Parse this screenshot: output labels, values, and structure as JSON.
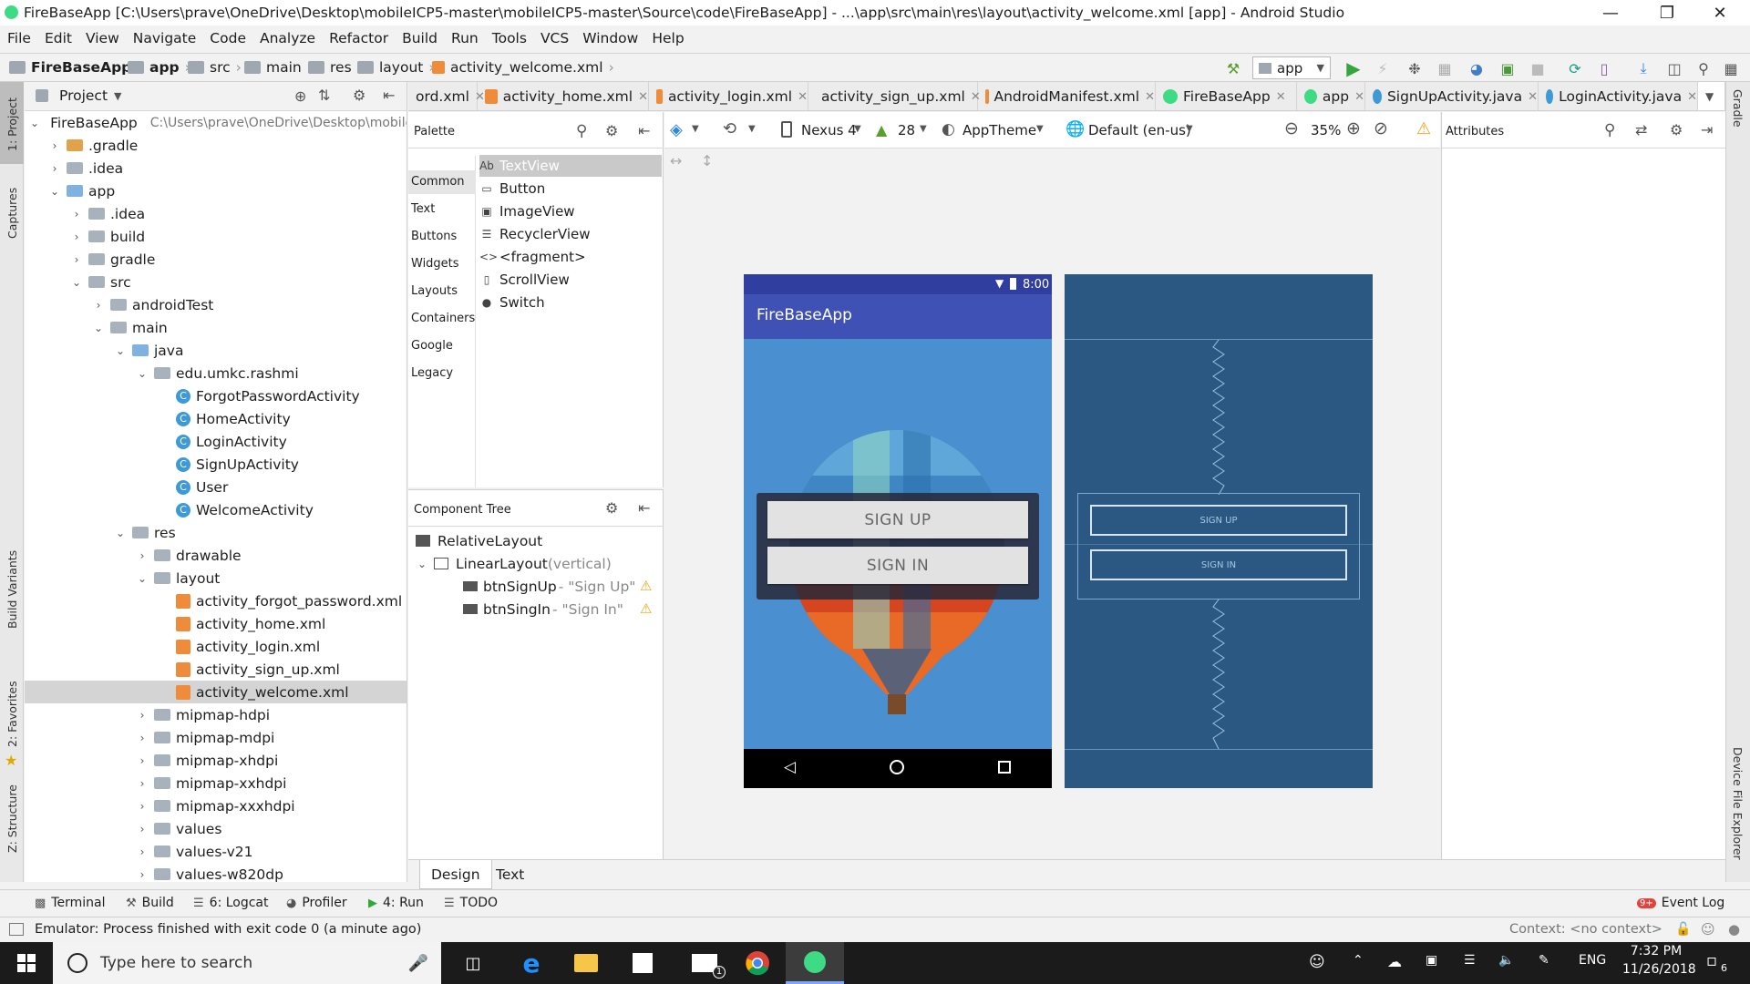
{
  "window": {
    "title": "FireBaseApp [C:\\Users\\prave\\OneDrive\\Desktop\\mobileICP5-master\\mobileICP5-master\\Source\\code\\FireBaseApp] - ...\\app\\src\\main\\res\\layout\\activity_welcome.xml [app] - Android Studio"
  },
  "menu": [
    "File",
    "Edit",
    "View",
    "Navigate",
    "Code",
    "Analyze",
    "Refactor",
    "Build",
    "Run",
    "Tools",
    "VCS",
    "Window",
    "Help"
  ],
  "breadcrumbs": [
    "FireBaseApp",
    "app",
    "src",
    "main",
    "res",
    "layout",
    "activity_welcome.xml"
  ],
  "toolbar": {
    "run_config": "app"
  },
  "left_strip": {
    "project": "1: Project",
    "captures": "Captures",
    "build_variants": "Build Variants",
    "favorites": "2: Favorites",
    "structure": "Z: Structure"
  },
  "right_strip": {
    "gradle": "Gradle",
    "device_file_explorer": "Device File Explorer"
  },
  "project_panel": {
    "header": "Project",
    "tree": [
      {
        "label": "FireBaseApp",
        "extra": "C:\\Users\\prave\\OneDrive\\Desktop\\mobile"
      },
      {
        "label": ".gradle"
      },
      {
        "label": ".idea"
      },
      {
        "label": "app"
      },
      {
        "label": ".idea"
      },
      {
        "label": "build"
      },
      {
        "label": "gradle"
      },
      {
        "label": "src"
      },
      {
        "label": "androidTest"
      },
      {
        "label": "main"
      },
      {
        "label": "java"
      },
      {
        "label": "edu.umkc.rashmi"
      },
      {
        "label": "ForgotPasswordActivity"
      },
      {
        "label": "HomeActivity"
      },
      {
        "label": "LoginActivity"
      },
      {
        "label": "SignUpActivity"
      },
      {
        "label": "User"
      },
      {
        "label": "WelcomeActivity"
      },
      {
        "label": "res"
      },
      {
        "label": "drawable"
      },
      {
        "label": "layout"
      },
      {
        "label": "activity_forgot_password.xml"
      },
      {
        "label": "activity_home.xml"
      },
      {
        "label": "activity_login.xml"
      },
      {
        "label": "activity_sign_up.xml"
      },
      {
        "label": "activity_welcome.xml"
      },
      {
        "label": "mipmap-hdpi"
      },
      {
        "label": "mipmap-mdpi"
      },
      {
        "label": "mipmap-xhdpi"
      },
      {
        "label": "mipmap-xxhdpi"
      },
      {
        "label": "mipmap-xxxhdpi"
      },
      {
        "label": "values"
      },
      {
        "label": "values-v21"
      },
      {
        "label": "values-w820dp"
      }
    ]
  },
  "tabs": [
    "ord.xml",
    "activity_home.xml",
    "activity_login.xml",
    "activity_sign_up.xml",
    "AndroidManifest.xml",
    "FireBaseApp",
    "app",
    "SignUpActivity.java",
    "LoginActivity.java"
  ],
  "palette": {
    "title": "Palette",
    "categories": [
      "Common",
      "Text",
      "Buttons",
      "Widgets",
      "Layouts",
      "Containers",
      "Google",
      "Legacy"
    ],
    "items": [
      "TextView",
      "Button",
      "ImageView",
      "RecyclerView",
      "<fragment>",
      "ScrollView",
      "Switch"
    ]
  },
  "component_tree": {
    "title": "Component Tree",
    "nodes": [
      {
        "label": "RelativeLayout",
        "sub": ""
      },
      {
        "label": "LinearLayout",
        "sub": "(vertical)"
      },
      {
        "label": "btnSignUp",
        "sub": "- \"Sign Up\""
      },
      {
        "label": "btnSingIn",
        "sub": "- \"Sign In\""
      }
    ]
  },
  "design_toolbar": {
    "device": "Nexus 4",
    "api": "28",
    "theme": "AppTheme",
    "locale": "Default (en-us)",
    "zoom": "35%"
  },
  "attributes": {
    "title": "Attributes"
  },
  "phone": {
    "time": "8:00",
    "app_title": "FireBaseApp",
    "btn_signup": "SIGN UP",
    "btn_signin": "SIGN IN"
  },
  "blueprint": {
    "btn_signup": "SIGN UP",
    "btn_signin": "SIGN IN"
  },
  "editor_mode_tabs": [
    "Design",
    "Text"
  ],
  "tool_windows": [
    "Terminal",
    "Build",
    "6: Logcat",
    "Profiler",
    "4: Run",
    "TODO"
  ],
  "event_log": {
    "badge": "9+",
    "label": "Event Log"
  },
  "status": {
    "message": "Emulator: Process finished with exit code 0 (a minute ago)",
    "context": "Context: <no context>"
  },
  "taskbar": {
    "search_placeholder": "Type here to search",
    "lang": "ENG",
    "time": "7:32 PM",
    "date": "11/26/2018",
    "notif_count": "6",
    "mail_badge": "1"
  },
  "colors": {
    "app_bar": "#3f51b5",
    "status_bar": "#303f9f",
    "blueprint_bg": "#2a5882",
    "warning": "#f0a30a"
  }
}
